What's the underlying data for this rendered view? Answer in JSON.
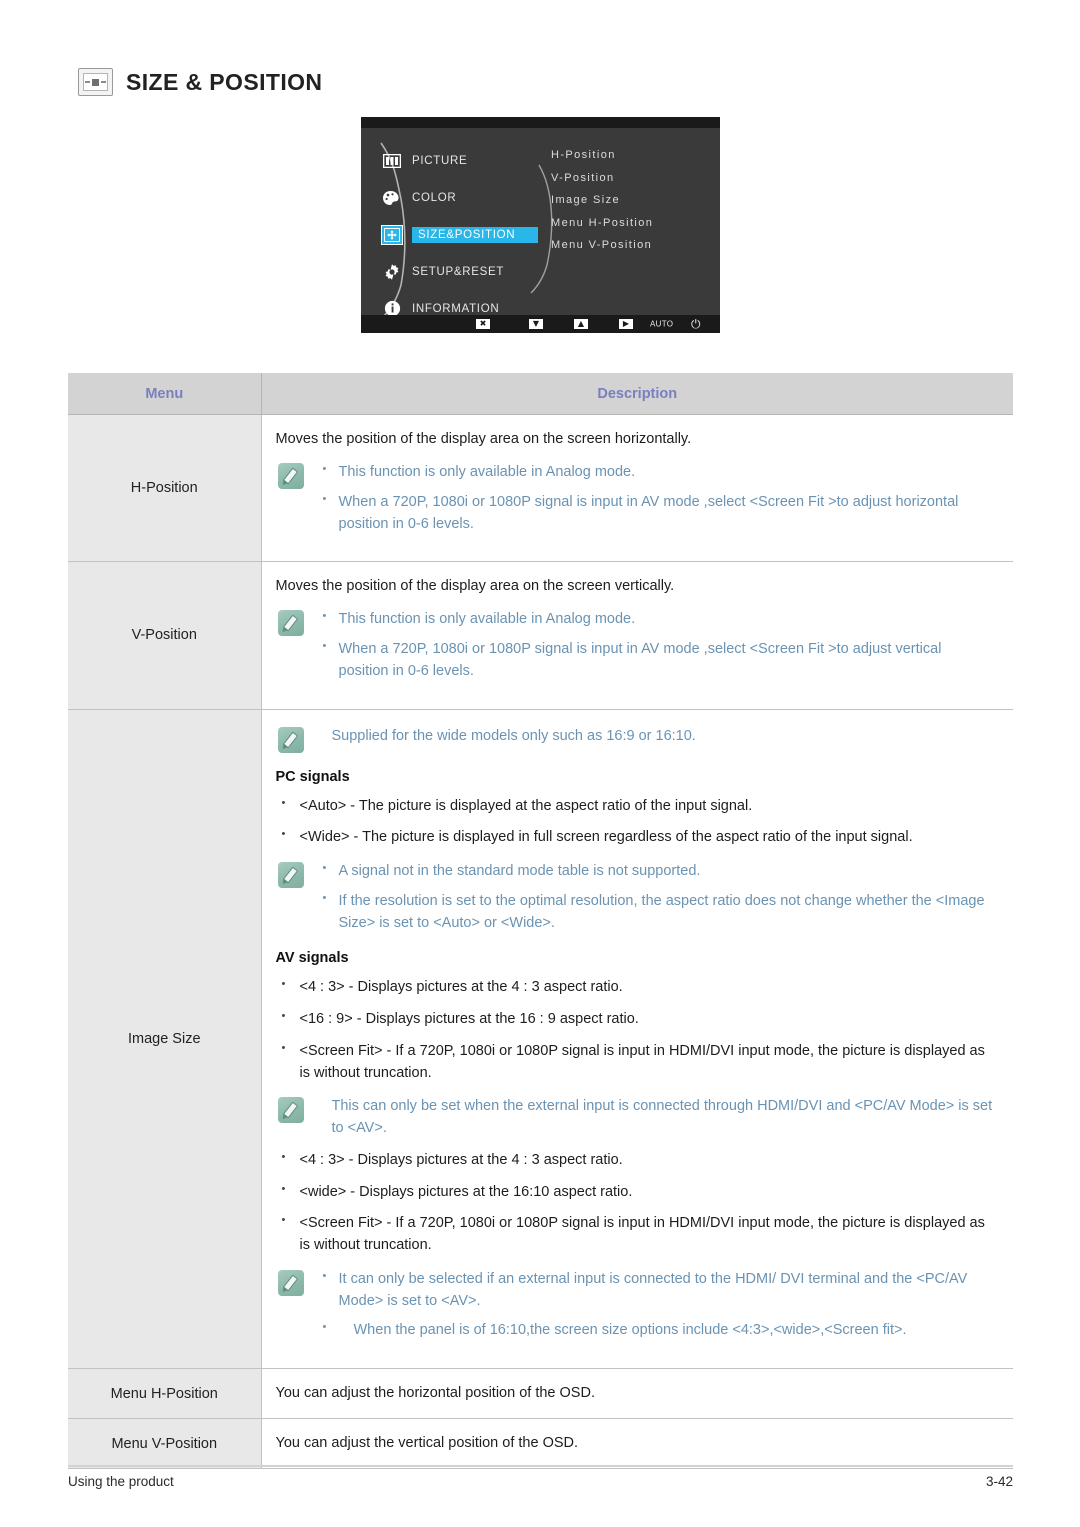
{
  "section": {
    "title": "SIZE & POSITION",
    "icon": "size-position-icon"
  },
  "osd": {
    "left_menu": [
      {
        "label": "PICTURE",
        "icon": "picture-icon",
        "selected": false
      },
      {
        "label": "COLOR",
        "icon": "color-palette-icon",
        "selected": false
      },
      {
        "label": "SIZE&POSITION",
        "icon": "size-position-icon",
        "selected": true
      },
      {
        "label": "SETUP&RESET",
        "icon": "gear-icon",
        "selected": false
      },
      {
        "label": "INFORMATION",
        "icon": "info-icon",
        "selected": false
      }
    ],
    "submenu": [
      "H-Position",
      "V-Position",
      "Image Size",
      "Menu H-Position",
      "Menu V-Position"
    ],
    "bottom_bar": [
      {
        "name": "exit-icon",
        "glyph": "✖"
      },
      {
        "name": "down-icon",
        "glyph": "▼"
      },
      {
        "name": "up-icon",
        "glyph": "▲"
      },
      {
        "name": "enter-icon",
        "glyph": "▶"
      },
      {
        "name": "auto-label",
        "glyph": "AUTO"
      },
      {
        "name": "power-icon",
        "glyph": "⏻"
      }
    ],
    "highlight_color": "#29b6e8"
  },
  "table": {
    "headers": {
      "menu": "Menu",
      "description": "Description"
    },
    "rows": {
      "h_position": {
        "menu": "H-Position",
        "intro": "Moves the position of the display area on the screen horizontally.",
        "note": [
          "This function is only available in Analog mode.",
          "When a 720P, 1080i or 1080P signal is input in AV mode ,select <Screen Fit  >to adjust horizontal position in 0-6 levels."
        ]
      },
      "v_position": {
        "menu": "V-Position",
        "intro": "Moves the position of the display area on the screen vertically.",
        "note": [
          "This function is only available in Analog mode.",
          "When a 720P, 1080i or 1080P signal is input in AV mode ,select <Screen Fit  >to adjust vertical position in 0-6 levels."
        ]
      },
      "image_size": {
        "menu": "Image Size",
        "note_top": "Supplied for the wide models only such as 16:9 or 16:10.",
        "pc_heading": "PC signals",
        "pc_bullets": [
          "<Auto> - The picture is displayed at the aspect ratio of the input signal.",
          "<Wide> - The picture is displayed in full screen regardless of the aspect ratio of the input signal."
        ],
        "pc_note": [
          "A signal not in the standard mode table is not supported.",
          "If the resolution is set to the optimal resolution, the aspect ratio does not change whether the <Image Size> is set to <Auto> or <Wide>."
        ],
        "av_heading": "AV signals",
        "av_bullets_1": [
          "<4 : 3> - Displays pictures at the 4 : 3 aspect ratio.",
          "<16 : 9> - Displays pictures at the 16 : 9 aspect ratio.",
          "<Screen Fit> - If a 720P, 1080i or 1080P signal is input in HDMI/DVI input mode, the picture is displayed as is without truncation."
        ],
        "av_note_mid": "This can only be set when the external input is connected through HDMI/DVI and <PC/AV Mode> is set to <AV>.",
        "av_bullets_2": [
          "<4 : 3> - Displays pictures at the 4 : 3 aspect ratio.",
          "<wide> - Displays pictures at the 16:10 aspect ratio.",
          "<Screen Fit> - If a 720P, 1080i or 1080P signal is input in HDMI/DVI input mode, the picture is displayed as is without truncation."
        ],
        "av_note_end": [
          "It can only be selected if an external input is connected to the HDMI/ DVI terminal and the <PC/AV Mode> is set to <AV>.",
          "When the panel is of 16:10,the screen size options include <4:3>,<wide>,<Screen fit>."
        ]
      },
      "menu_h_position": {
        "menu": "Menu H-Position",
        "text": "You can adjust the horizontal position of the OSD."
      },
      "menu_v_position": {
        "menu": "Menu V-Position",
        "text": "You can adjust the vertical position of the OSD."
      }
    }
  },
  "footer": {
    "left": "Using the product",
    "right": "3-42"
  },
  "colors": {
    "note_text": "#6a93b3",
    "header_text": "#7a7fbe",
    "header_bg": "#d3d3d3",
    "menu_cell_bg": "#e8e8e8",
    "osd_highlight": "#29b6e8"
  }
}
